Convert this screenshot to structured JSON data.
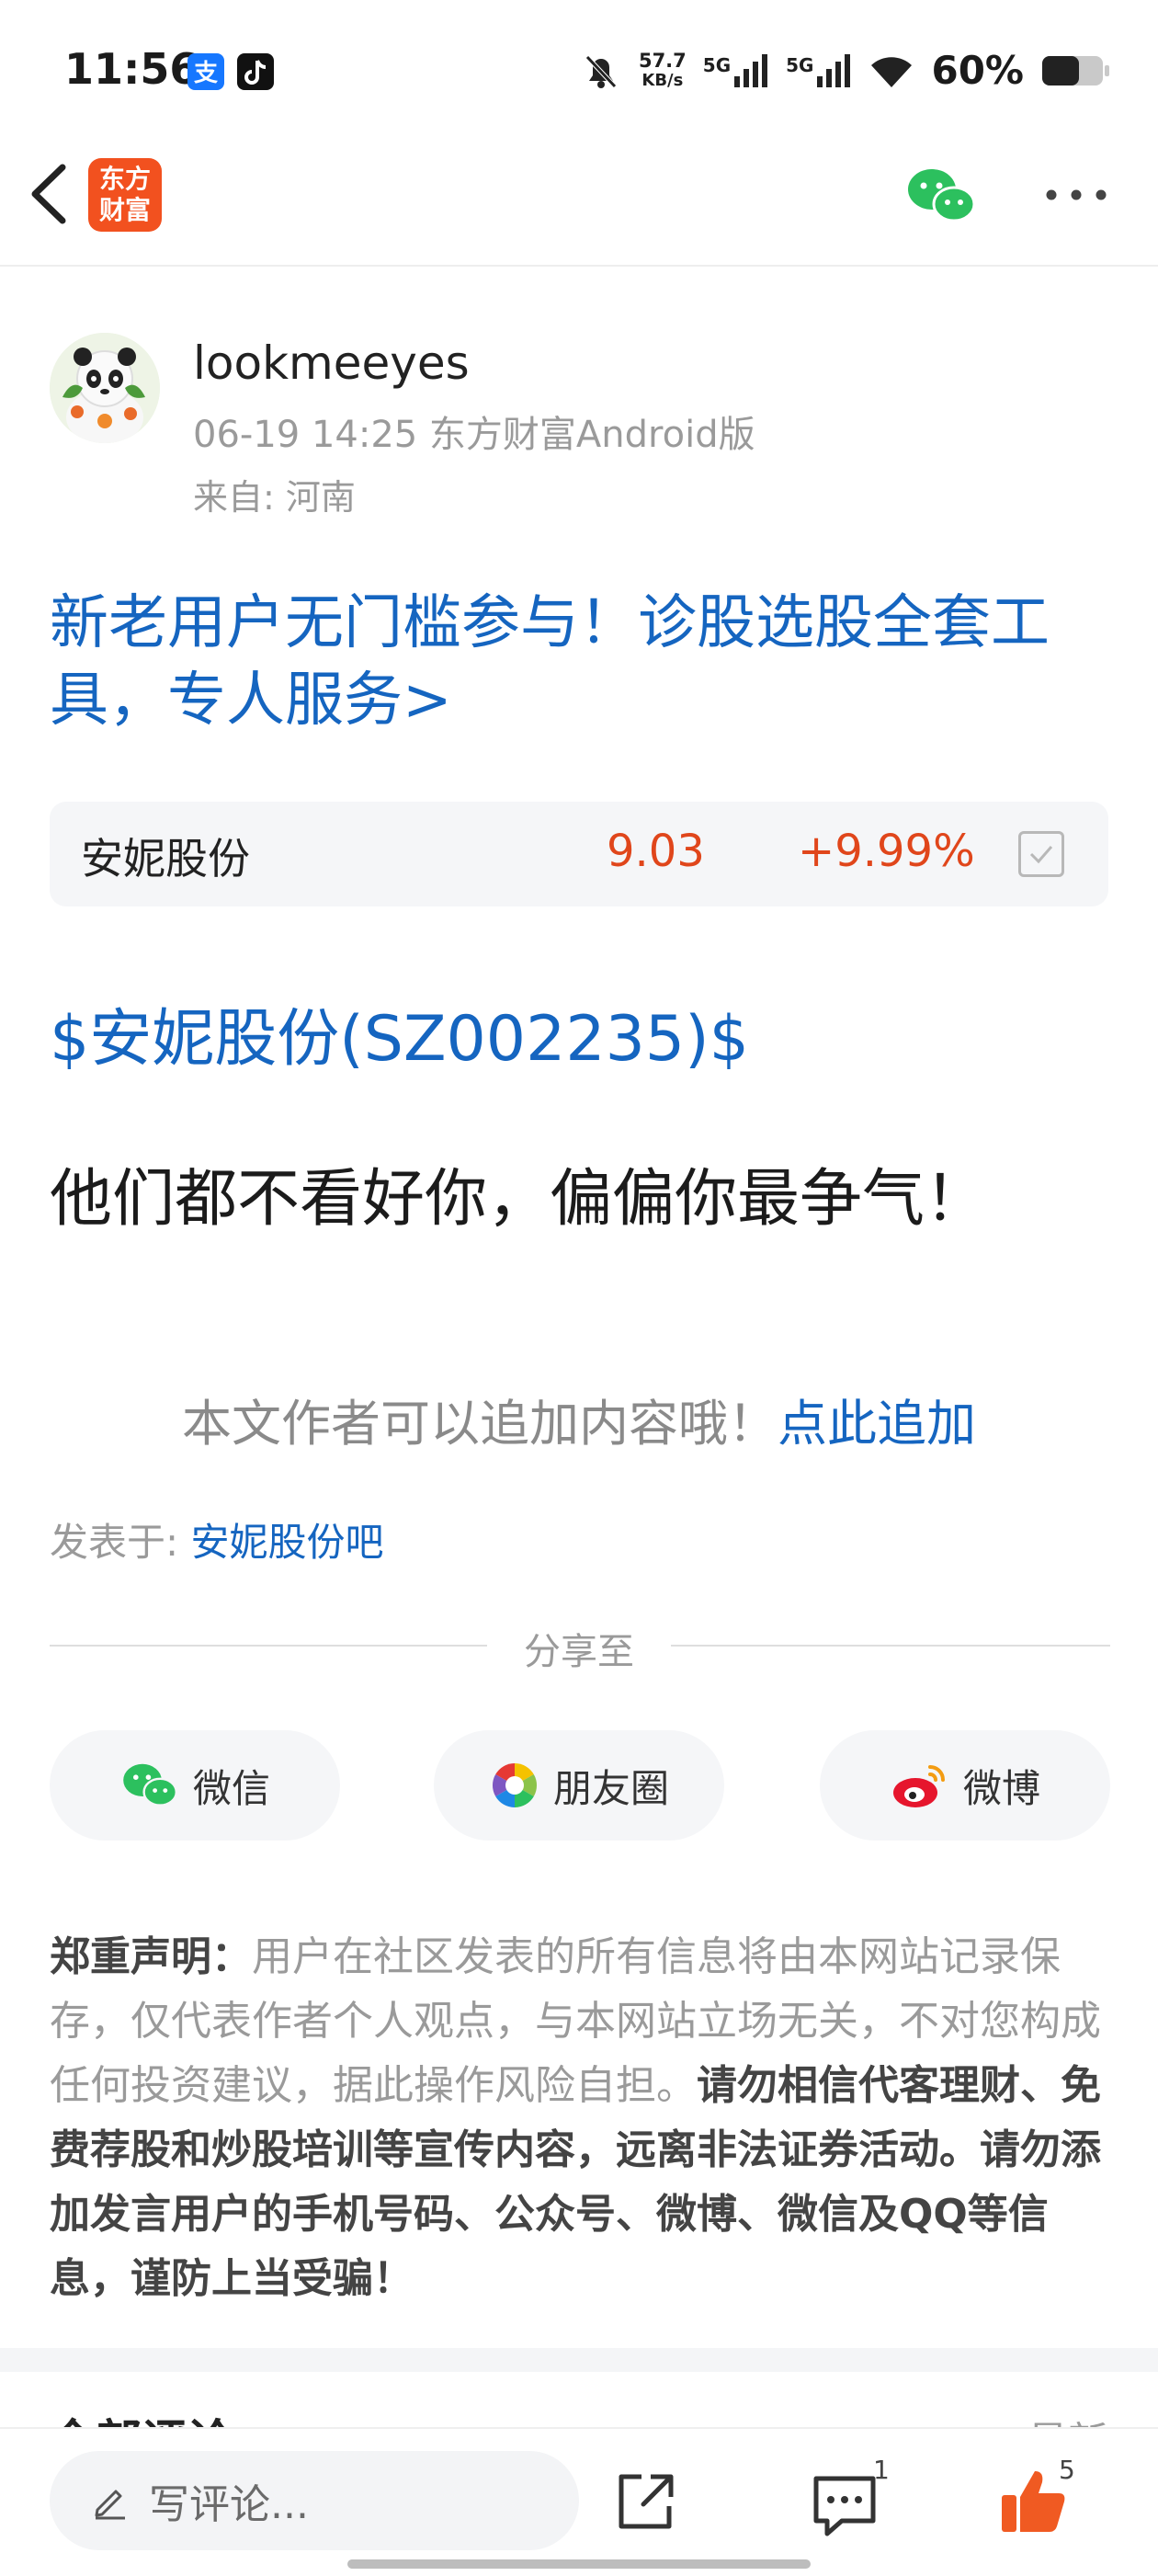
{
  "status_bar": {
    "time": "11:56",
    "speed_value": "57.7",
    "speed_unit": "KB/s",
    "sim1": "5G",
    "sim2": "5G",
    "battery": "60%"
  },
  "nav": {
    "logo_text": "东方\n财富",
    "share_icon": "wechat-icon",
    "more_icon": "more-icon"
  },
  "author": {
    "name": "lookmeeyes",
    "meta": "06-19 14:25 东方财富Android版",
    "from": "来自: 河南"
  },
  "promo": "新老用户无门槛参与！诊股选股全套工具，专人服务>",
  "stock": {
    "name": "安妮股份",
    "price": "9.03",
    "change": "+9.99%"
  },
  "post": {
    "stock_link": "$安妮股份(SZ002235)$",
    "text": "他们都不看好你，偏偏你最争气！"
  },
  "append": {
    "prompt": "本文作者可以追加内容哦！",
    "link": "点此追加"
  },
  "posted_in": {
    "label": "发表于: ",
    "forum": "安妮股份吧"
  },
  "share": {
    "title": "分享至",
    "wechat": "微信",
    "moments": "朋友圈",
    "weibo": "微博"
  },
  "disclaimer": {
    "title": "郑重声明：",
    "normal": "用户在社区发表的所有信息将由本网站记录保存，仅代表作者个人观点，与本网站立场无关，不对您构成任何投资建议，据此操作风险自担。",
    "bold": "请勿相信代客理财、免费荐股和炒股培训等宣传内容，远离非法证券活动。请勿添加发言用户的手机号码、公众号、微博、微信及QQ等信息，谨防上当受骗！"
  },
  "comments": {
    "header": "全部评论",
    "sort": "最新"
  },
  "bottom_bar": {
    "placeholder": "写评论...",
    "comment_count": "1",
    "like_count": "5"
  },
  "colors": {
    "link_blue": "#1565c0",
    "stock_red": "#e0461b",
    "brand_orange": "#f2511f"
  }
}
